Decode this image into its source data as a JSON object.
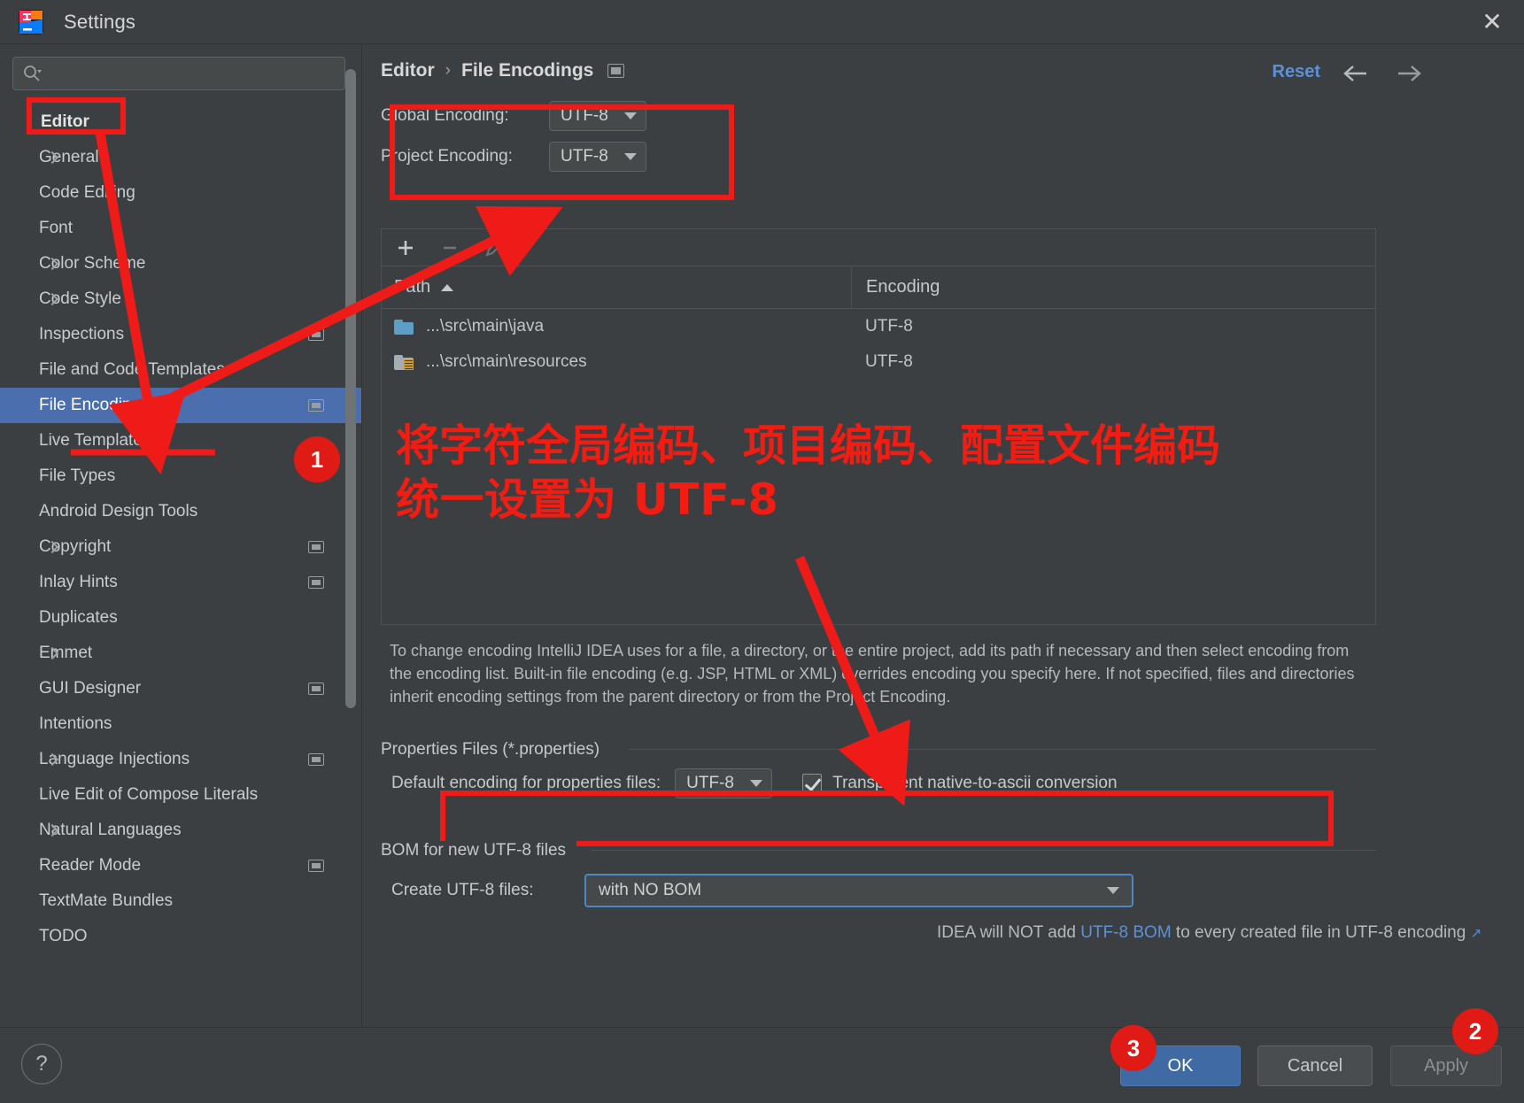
{
  "window": {
    "title": "Settings",
    "logo_name": "intellij-idea-logo",
    "close_label": "✕"
  },
  "sidebar": {
    "search": {
      "value": "",
      "placeholder": ""
    },
    "items": [
      {
        "label": "Editor",
        "level": 0,
        "chevron": false,
        "badge": false,
        "selected": false,
        "bold": true
      },
      {
        "label": "General",
        "level": 1,
        "chevron": true,
        "badge": false,
        "selected": false
      },
      {
        "label": "Code Editing",
        "level": 1,
        "chevron": false,
        "badge": false,
        "selected": false
      },
      {
        "label": "Font",
        "level": 1,
        "chevron": false,
        "badge": false,
        "selected": false
      },
      {
        "label": "Color Scheme",
        "level": 1,
        "chevron": true,
        "badge": false,
        "selected": false
      },
      {
        "label": "Code Style",
        "level": 1,
        "chevron": true,
        "badge": false,
        "selected": false
      },
      {
        "label": "Inspections",
        "level": 1,
        "chevron": false,
        "badge": true,
        "selected": false
      },
      {
        "label": "File and Code Templates",
        "level": 1,
        "chevron": false,
        "badge": false,
        "selected": false
      },
      {
        "label": "File Encodings",
        "level": 1,
        "chevron": false,
        "badge": true,
        "selected": true
      },
      {
        "label": "Live Templates",
        "level": 1,
        "chevron": false,
        "badge": false,
        "selected": false
      },
      {
        "label": "File Types",
        "level": 1,
        "chevron": false,
        "badge": false,
        "selected": false
      },
      {
        "label": "Android Design Tools",
        "level": 1,
        "chevron": false,
        "badge": false,
        "selected": false
      },
      {
        "label": "Copyright",
        "level": 1,
        "chevron": true,
        "badge": true,
        "selected": false
      },
      {
        "label": "Inlay Hints",
        "level": 1,
        "chevron": false,
        "badge": true,
        "selected": false
      },
      {
        "label": "Duplicates",
        "level": 1,
        "chevron": false,
        "badge": false,
        "selected": false
      },
      {
        "label": "Emmet",
        "level": 1,
        "chevron": true,
        "badge": false,
        "selected": false
      },
      {
        "label": "GUI Designer",
        "level": 1,
        "chevron": false,
        "badge": true,
        "selected": false
      },
      {
        "label": "Intentions",
        "level": 1,
        "chevron": false,
        "badge": false,
        "selected": false
      },
      {
        "label": "Language Injections",
        "level": 1,
        "chevron": true,
        "badge": true,
        "selected": false
      },
      {
        "label": "Live Edit of Compose Literals",
        "level": 1,
        "chevron": false,
        "badge": false,
        "selected": false
      },
      {
        "label": "Natural Languages",
        "level": 1,
        "chevron": true,
        "badge": false,
        "selected": false
      },
      {
        "label": "Reader Mode",
        "level": 1,
        "chevron": false,
        "badge": true,
        "selected": false
      },
      {
        "label": "TextMate Bundles",
        "level": 1,
        "chevron": false,
        "badge": false,
        "selected": false
      },
      {
        "label": "TODO",
        "level": 1,
        "chevron": false,
        "badge": false,
        "selected": false
      }
    ]
  },
  "header": {
    "breadcrumb_root": "Editor",
    "breadcrumb_sep": "›",
    "breadcrumb_leaf": "File Encodings",
    "reset_label": "Reset",
    "back_icon": "arrow-left-icon",
    "forward_icon": "arrow-right-icon"
  },
  "encodings": {
    "global_label": "Global Encoding:",
    "global_value": "UTF-8",
    "project_label": "Project Encoding:",
    "project_value": "UTF-8"
  },
  "table": {
    "toolbar": {
      "add": "+",
      "remove": "–",
      "edit": "edit-pencil-icon"
    },
    "columns": [
      "Path",
      "Encoding"
    ],
    "sort_column": "Path",
    "sort_direction": "ascending",
    "rows": [
      {
        "icon": "folder-source-icon",
        "path": "...\\src\\main\\java",
        "encoding": "UTF-8"
      },
      {
        "icon": "folder-resources-icon",
        "path": "...\\src\\main\\resources",
        "encoding": "UTF-8"
      }
    ]
  },
  "description": "To change encoding IntelliJ IDEA uses for a file, a directory, or the entire project, add its path if necessary and then select encoding from the encoding list. Built-in file encoding (e.g. JSP, HTML or XML) overrides encoding you specify here. If not specified, files and directories inherit encoding settings from the parent directory or from the Project Encoding.",
  "properties_section": {
    "title": "Properties Files (*.properties)",
    "default_encoding_label": "Default encoding for properties files:",
    "default_encoding_value": "UTF-8",
    "transparent_label": "Transparent native-to-ascii conversion",
    "transparent_checked": true
  },
  "bom_section": {
    "title": "BOM for new UTF-8 files",
    "create_label": "Create UTF-8 files:",
    "create_value": "with NO BOM",
    "note_prefix": "IDEA will NOT add ",
    "note_link": "UTF-8 BOM",
    "note_suffix": " to every created file in UTF-8 encoding",
    "note_external_icon": "↗"
  },
  "footer": {
    "help_label": "?",
    "ok_label": "OK",
    "cancel_label": "Cancel",
    "apply_label": "Apply"
  },
  "annotation": {
    "color": "#ee1b18",
    "line1": "将字符全局编码、项目编码、配置文件编码",
    "line2": "统一设置为 UTF-8",
    "badges": [
      {
        "text": "1"
      },
      {
        "text": "2"
      },
      {
        "text": "3"
      }
    ]
  }
}
